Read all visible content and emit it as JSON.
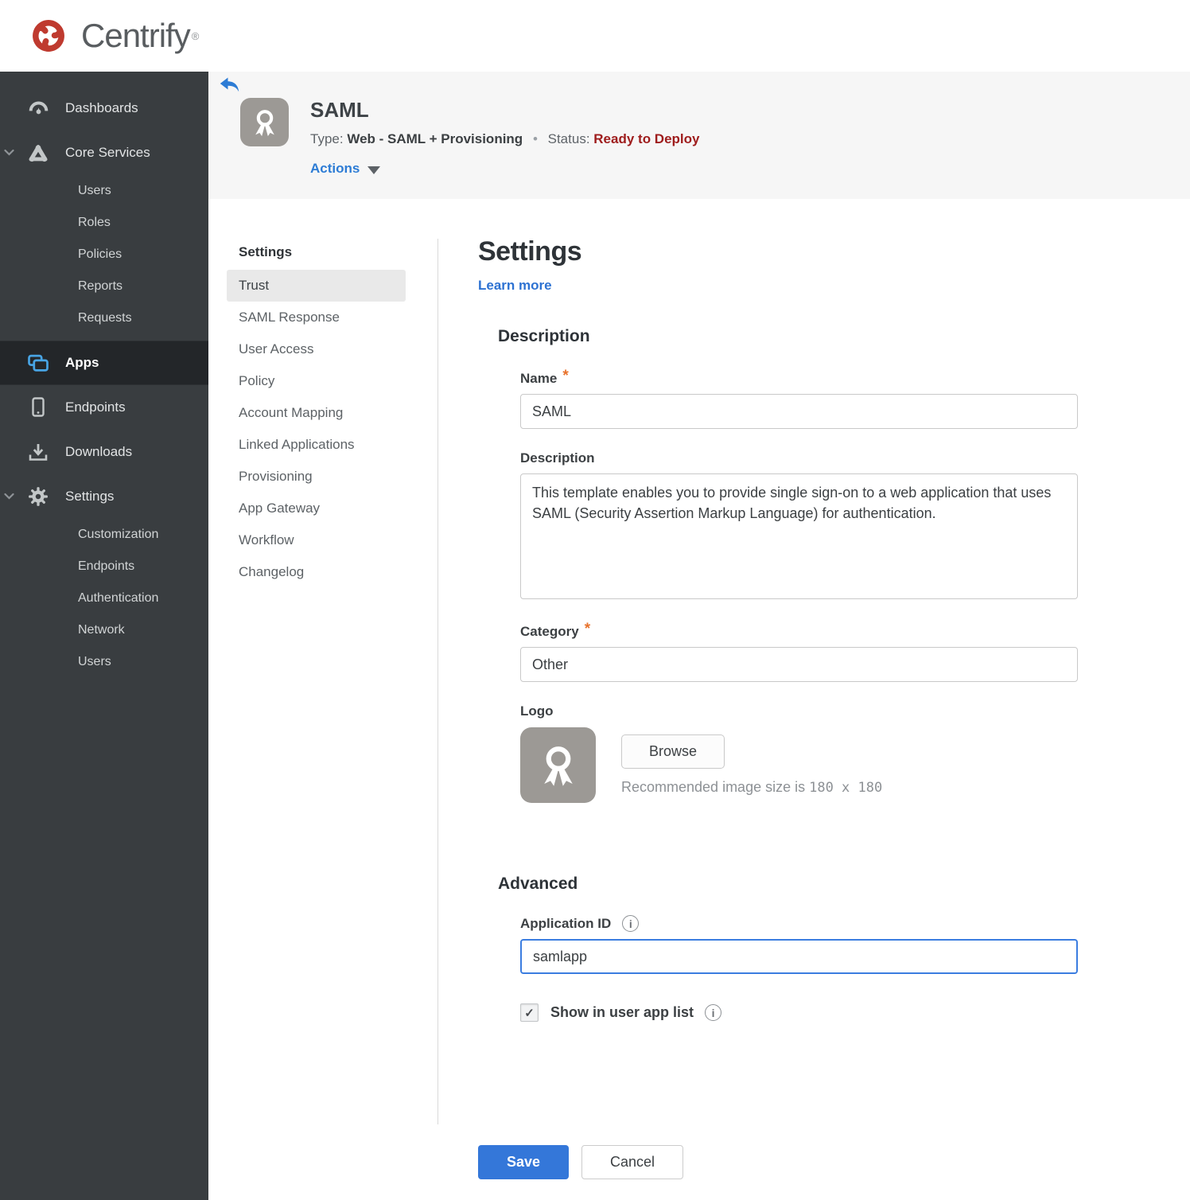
{
  "brand": {
    "name": "Centrify",
    "reg": "®",
    "logo_color": "#bf3a2f"
  },
  "sidebar": {
    "items": [
      {
        "label": "Dashboards",
        "icon": "gauge-icon"
      },
      {
        "label": "Core Services",
        "icon": "core-services-icon",
        "expanded": true,
        "children": [
          "Users",
          "Roles",
          "Policies",
          "Reports",
          "Requests"
        ]
      },
      {
        "label": "Apps",
        "icon": "apps-icon",
        "active": true,
        "accent": "#48a4e4"
      },
      {
        "label": "Endpoints",
        "icon": "endpoint-icon"
      },
      {
        "label": "Downloads",
        "icon": "download-icon"
      },
      {
        "label": "Settings",
        "icon": "gear-icon",
        "expanded": true,
        "children": [
          "Customization",
          "Endpoints",
          "Authentication",
          "Network",
          "Users"
        ]
      }
    ]
  },
  "header": {
    "app_name": "SAML",
    "type_label": "Type:",
    "type_value": "Web - SAML + Provisioning",
    "separator": "•",
    "status_label": "Status:",
    "status_value": "Ready to Deploy",
    "status_color": "#9e1c1c",
    "actions_label": "Actions"
  },
  "subnav": {
    "title": "Settings",
    "active_item": "Trust",
    "items": [
      "Trust",
      "SAML Response",
      "User Access",
      "Policy",
      "Account Mapping",
      "Linked Applications",
      "Provisioning",
      "App Gateway",
      "Workflow",
      "Changelog"
    ]
  },
  "main": {
    "title": "Settings",
    "learn_more": "Learn more",
    "description_section": {
      "title": "Description",
      "name_label": "Name",
      "name_required": "*",
      "name_value": "SAML",
      "description_label": "Description",
      "description_value": "This template enables you to provide single sign-on to a web application that uses SAML (Security Assertion Markup Language) for authentication.",
      "category_label": "Category",
      "category_required": "*",
      "category_value": "Other",
      "logo_label": "Logo",
      "browse_label": "Browse",
      "logo_hint_prefix": "Recommended image size is ",
      "logo_hint_size": "180 x 180"
    },
    "advanced_section": {
      "title": "Advanced",
      "application_id_label": "Application ID",
      "application_id_value": "samlapp",
      "show_in_app_list_label": "Show in user app list",
      "show_in_app_list_checked": true
    },
    "save_label": "Save",
    "cancel_label": "Cancel"
  },
  "colors": {
    "accent_blue": "#2d7cd5",
    "save_blue": "#3477d9",
    "status_red": "#9e1c1c",
    "required_orange": "#e8722c",
    "sidebar_bg": "#393d40",
    "sidebar_active_bg": "#232629",
    "header_band": "#f6f6f6"
  },
  "icons": {
    "check": "✓",
    "info": "i"
  }
}
